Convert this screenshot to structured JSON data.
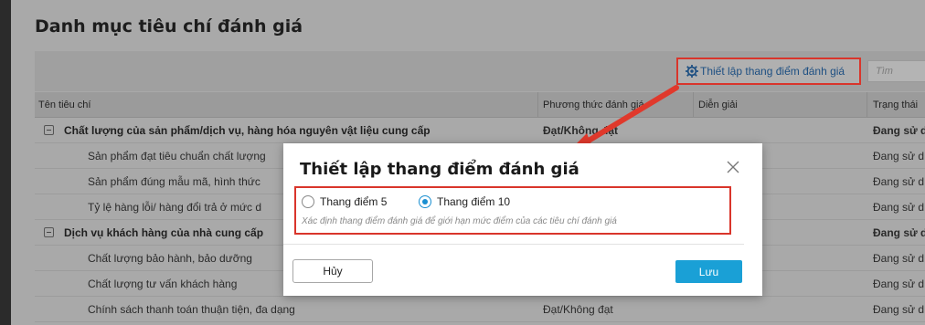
{
  "page": {
    "title": "Danh mục tiêu chí đánh giá"
  },
  "toolbar": {
    "setting_button_label": "Thiết lập thang điểm đánh giá",
    "setting_icon": "gear-icon",
    "search_placeholder": "Tìm"
  },
  "table": {
    "headers": [
      "Tên tiêu chí",
      "Phương thức đánh giá",
      "Diễn giải",
      "Trạng thái"
    ],
    "rows": [
      {
        "type": "group",
        "name": "Chất lượng của sản phẩm/dịch vụ, hàng hóa nguyên vật liệu cung cấp",
        "method": "Đạt/Không đạt",
        "status": "Đang sử d"
      },
      {
        "type": "item",
        "name": "Sản phẩm đạt tiêu chuẩn chất lượng",
        "method": "",
        "status": "Đang sử d"
      },
      {
        "type": "item",
        "name": "Sản phẩm đúng mẫu mã, hình thức",
        "method": "",
        "status": "Đang sử d"
      },
      {
        "type": "item",
        "name": "Tỷ lệ hàng lỗi/ hàng đổi trả ở mức d",
        "method": "",
        "status": "Đang sử d"
      },
      {
        "type": "group",
        "name": "Dịch vụ khách hàng của nhà cung cấp",
        "method": "",
        "status": "Đang sử d"
      },
      {
        "type": "item",
        "name": "Chất lượng bảo hành, bảo dưỡng",
        "method": "",
        "status": "Đang sử d"
      },
      {
        "type": "item",
        "name": "Chất lượng tư vấn khách hàng",
        "method": "",
        "status": "Đang sử d"
      },
      {
        "type": "item",
        "name": "Chính sách thanh toán thuận tiện, đa dạng",
        "method": "Đạt/Không đạt",
        "status": "Đang sử d"
      }
    ]
  },
  "modal": {
    "title": "Thiết lập thang điểm đánh giá",
    "option_5": "Thang điểm 5",
    "option_10": "Thang điểm 10",
    "selected_option": "Thang điểm 10",
    "hint": "Xác định thang điểm đánh giá để giới hạn mức điểm của các tiêu chí đánh giá",
    "cancel_label": "Hủy",
    "save_label": "Lưu"
  },
  "colors": {
    "highlight_border": "#d9352b",
    "accent": "#1aa0d6",
    "link": "#1d4f82"
  }
}
